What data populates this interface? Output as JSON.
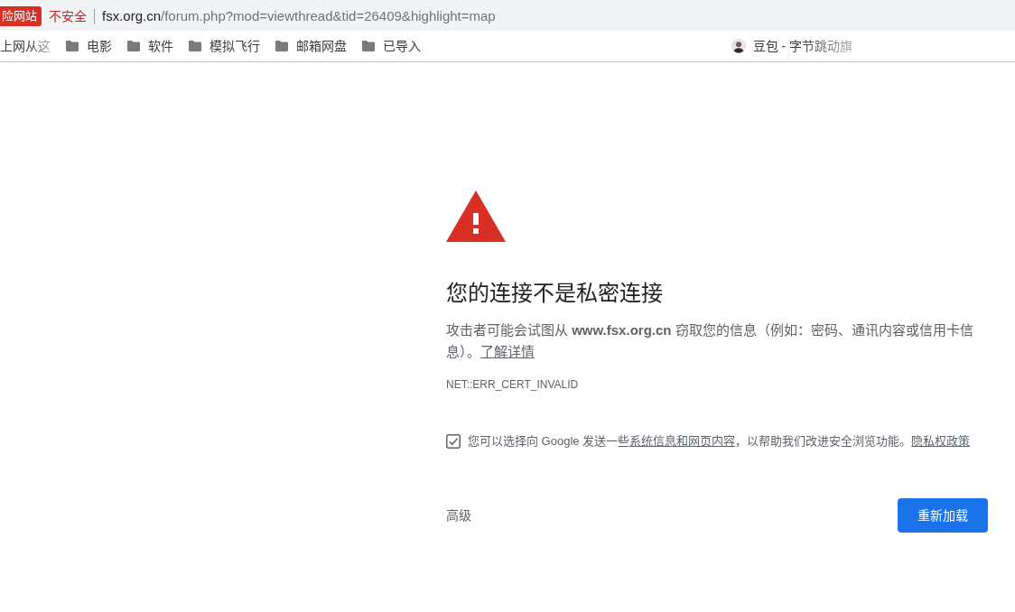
{
  "address_bar": {
    "warning_badge": "险网站",
    "security_label": "不安全",
    "url_host": "fsx.org.cn",
    "url_path": "/forum.php?mod=viewthread&tid=26409&highlight=map"
  },
  "bookmarks_bar": {
    "items": [
      {
        "kind": "plain",
        "label": "上网从这",
        "truncated": true
      },
      {
        "kind": "folder",
        "label": "电影",
        "truncated": false
      },
      {
        "kind": "folder",
        "label": "软件",
        "truncated": false
      },
      {
        "kind": "folder",
        "label": "模拟飞行",
        "truncated": false
      },
      {
        "kind": "folder",
        "label": "邮箱网盘",
        "truncated": false
      },
      {
        "kind": "folder",
        "label": "已导入",
        "truncated": false
      },
      {
        "kind": "site",
        "label": "豆包 - 字节跳动旗",
        "truncated": true
      }
    ]
  },
  "interstitial": {
    "heading": "您的连接不是私密连接",
    "message": "攻击者可能会试图从 **www.fsx.org.cn** 窃取您的信息（例如：密码、通讯内容或信用卡信息）。",
    "learn_more_link": "了解详情",
    "error_code": "NET::ERR_CERT_INVALID",
    "opt_in": {
      "checked": true,
      "text_before": "您可以选择向 Google 发送一些",
      "info_link": "系统信息和网页内容",
      "text_after": "，以帮助我们改进安全浏览功能。",
      "privacy_link": "隐私权政策"
    },
    "advanced_button": "高级",
    "reload_button": "重新加载"
  }
}
